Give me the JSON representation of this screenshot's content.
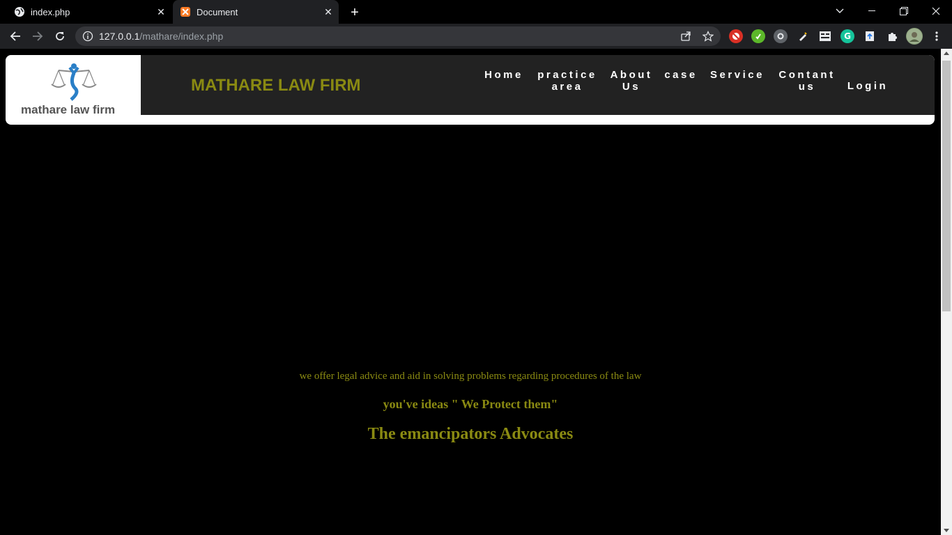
{
  "browser": {
    "tabs": [
      {
        "title": "index.php",
        "active": false,
        "icon": "globe-icon"
      },
      {
        "title": "Document",
        "active": true,
        "icon": "xampp-icon"
      }
    ],
    "url_host": "127.0.0.1",
    "url_path": "/mathare/index.php"
  },
  "site": {
    "logo_text": "mathare law firm",
    "brand_title": "MATHARE LAW FIRM",
    "nav": [
      {
        "label": "Home"
      },
      {
        "label": "practice\narea"
      },
      {
        "label": "About\nUs"
      },
      {
        "label": "case"
      },
      {
        "label": "Service"
      },
      {
        "label": "Contant\nus"
      },
      {
        "label": "Login"
      }
    ],
    "colors": {
      "accent": "#8a8a12",
      "header_bg": "#222222",
      "page_bg": "#000000"
    }
  },
  "content": {
    "line1": "we offer legal advice and aid in solving problems regarding procedures of the law",
    "line2": "you've ideas \" We Protect them\"",
    "line3": "The emancipators Advocates"
  }
}
